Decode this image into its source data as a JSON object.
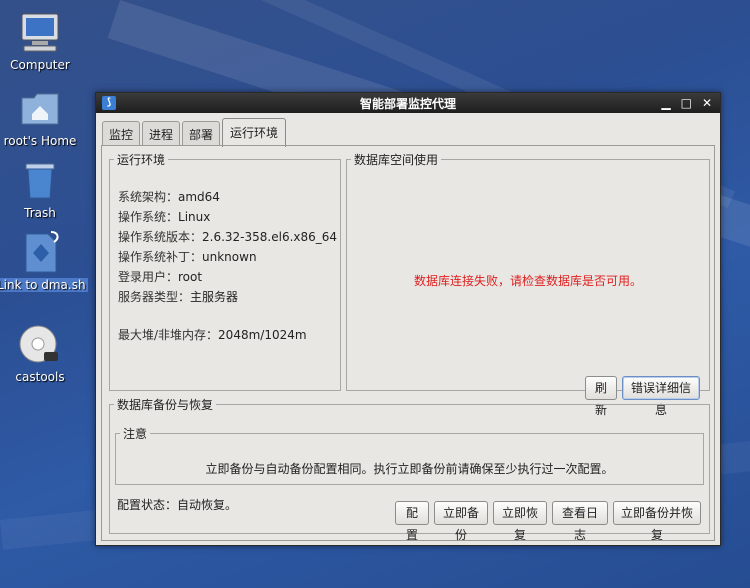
{
  "desktop": {
    "icons": [
      {
        "label": "Computer",
        "icon": "computer-icon"
      },
      {
        "label": "root's Home",
        "icon": "home-folder-icon"
      },
      {
        "label": "Trash",
        "icon": "trash-icon"
      },
      {
        "label": "Link to dma.sh",
        "icon": "script-link-icon"
      },
      {
        "label": "castools",
        "icon": "cd-icon"
      }
    ]
  },
  "window": {
    "title": "智能部署监控代理",
    "controls": {
      "minimize": "▁",
      "maximize": "□",
      "close": "✕"
    },
    "tabs": [
      {
        "label": "监控",
        "active": false
      },
      {
        "label": "进程",
        "active": false
      },
      {
        "label": "部署",
        "active": false
      },
      {
        "label": "运行环境",
        "active": true
      }
    ]
  },
  "runtime": {
    "legend": "运行环境",
    "rows": [
      {
        "key": "系统架构：",
        "value": "amd64"
      },
      {
        "key": "操作系统：",
        "value": "Linux"
      },
      {
        "key": "操作系统版本：",
        "value": "2.6.32-358.el6.x86_64"
      },
      {
        "key": "操作系统补丁：",
        "value": "unknown"
      },
      {
        "key": "登录用户：",
        "value": "root"
      },
      {
        "key": "服务器类型：",
        "value": "主服务器"
      }
    ],
    "memory": {
      "key": "最大堆/非堆内存：",
      "value": "2048m/1024m"
    }
  },
  "db_space": {
    "legend": "数据库空间使用",
    "error": "数据库连接失败，请检查数据库是否可用。",
    "refresh_label": "刷新",
    "detail_label": "错误详细信息"
  },
  "backup": {
    "legend": "数据库备份与恢复",
    "note_legend": "注意",
    "note_text": "立即备份与自动备份配置相同。执行立即备份前请确保至少执行过一次配置。",
    "status_label": "配置状态：",
    "status_value": "自动恢复。",
    "buttons": {
      "configure": "配置",
      "backup_now": "立即备份",
      "restore_now": "立即恢复",
      "view_log": "查看日志",
      "backup_and_restore": "立即备份并恢复"
    }
  },
  "colors": {
    "error": "#e02020",
    "title_bar": "#2a2a2a",
    "selection": "#4c7ac8"
  }
}
